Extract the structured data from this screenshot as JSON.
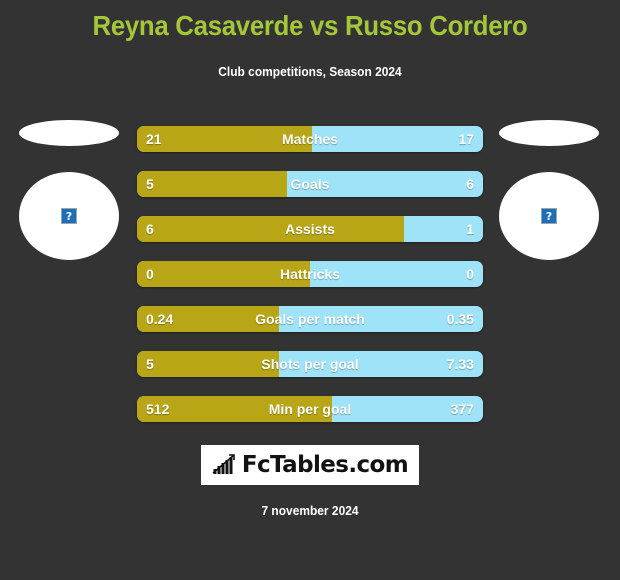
{
  "header": {
    "title": "Reyna Casaverde vs Russo Cordero",
    "subtitle": "Club competitions, Season 2024"
  },
  "colors": {
    "background": "#333333",
    "title_green": "#a5c639",
    "home_gold": "#b8a617",
    "away_blue": "#9fe3f9",
    "text_white": "#ffffff",
    "broken_icon_blue": "#1f6fb5"
  },
  "players": {
    "home": {
      "name": "Reyna Casaverde",
      "photo_icon": "broken-image-icon",
      "photo_glyph": "?"
    },
    "away": {
      "name": "Russo Cordero",
      "photo_icon": "broken-image-icon",
      "photo_glyph": "?"
    }
  },
  "chart_data": {
    "type": "bar",
    "title": "Reyna Casaverde vs Russo Cordero",
    "subtitle": "Club competitions, Season 2024",
    "orientation": "horizontal-diverging",
    "categories": [
      "Matches",
      "Goals",
      "Assists",
      "Hattricks",
      "Goals per match",
      "Shots per goal",
      "Min per goal"
    ],
    "series": [
      {
        "name": "Reyna Casaverde",
        "color": "#b8a617",
        "values": [
          21,
          5,
          6,
          0,
          0.24,
          5,
          512
        ]
      },
      {
        "name": "Russo Cordero",
        "color": "#9fe3f9",
        "values": [
          17,
          6,
          1,
          0,
          0.35,
          7.33,
          377
        ]
      }
    ],
    "legend": "none",
    "grid": false
  },
  "rows": [
    {
      "label": "Matches",
      "home": "21",
      "away": "17",
      "fill_pct": 50.6
    },
    {
      "label": "Goals",
      "home": "5",
      "away": "6",
      "fill_pct": 43.4
    },
    {
      "label": "Assists",
      "home": "6",
      "away": "1",
      "fill_pct": 77.2
    },
    {
      "label": "Hattricks",
      "home": "0",
      "away": "0",
      "fill_pct": 50.0
    },
    {
      "label": "Goals per match",
      "home": "0.24",
      "away": "0.35",
      "fill_pct": 41.0
    },
    {
      "label": "Shots per goal",
      "home": "5",
      "away": "7.33",
      "fill_pct": 41.0
    },
    {
      "label": "Min per goal",
      "home": "512",
      "away": "377",
      "fill_pct": 56.4
    }
  ],
  "logo": {
    "text": "FcTables.com",
    "icon": "bar-chart-trending-up-icon"
  },
  "footer": {
    "date": "7 november 2024"
  }
}
